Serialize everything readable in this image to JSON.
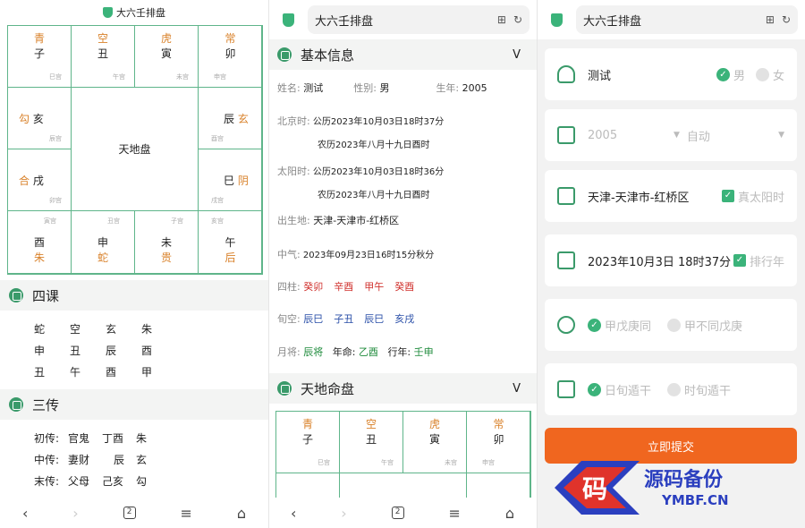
{
  "app": {
    "title": "大六壬排盘"
  },
  "grid": {
    "top": [
      {
        "god": "青",
        "branch": "子",
        "palace": "巳宫"
      },
      {
        "god": "空",
        "branch": "丑",
        "palace": "午宫"
      },
      {
        "god": "虎",
        "branch": "寅",
        "palace": "未宫"
      },
      {
        "god": "常",
        "branch": "卯",
        "palace": "申宫"
      }
    ],
    "left": [
      {
        "god": "勾",
        "branch": "亥",
        "palace": "辰宫"
      },
      {
        "god": "合",
        "branch": "戌",
        "palace": "卯宫"
      }
    ],
    "right": [
      {
        "god": "玄",
        "branch": "辰",
        "palace": "酉宫"
      },
      {
        "god": "阴",
        "branch": "巳",
        "palace": "戌宫"
      }
    ],
    "bottom": [
      {
        "god": "朱",
        "branch": "酉",
        "palace": "寅宫"
      },
      {
        "god": "蛇",
        "branch": "申",
        "palace": "丑宫"
      },
      {
        "god": "贵",
        "branch": "未",
        "palace": "子宫"
      },
      {
        "god": "后",
        "branch": "午",
        "palace": "亥宫"
      }
    ],
    "center": "天地盘"
  },
  "sike": {
    "title": "四课",
    "rows": [
      [
        "蛇",
        "空",
        "玄",
        "朱"
      ],
      [
        "申",
        "丑",
        "辰",
        "酉"
      ],
      [
        "丑",
        "午",
        "酉",
        "甲"
      ]
    ]
  },
  "sanchuan": {
    "title": "三传",
    "rows": [
      [
        "初传:",
        "官鬼",
        "丁酉",
        "朱"
      ],
      [
        "中传:",
        "妻财",
        "辰",
        "玄"
      ],
      [
        "末传:",
        "父母",
        "己亥",
        "勾"
      ]
    ]
  },
  "nav": {
    "back": "‹",
    "forward": "›",
    "tabs": "2",
    "menu": "≡",
    "home": "⌂"
  },
  "basic": {
    "title": "基本信息",
    "toggle": "V",
    "name_label": "姓名:",
    "name": "测试",
    "sex_label": "性别:",
    "sex": "男",
    "year_label": "生年:",
    "year": "2005",
    "bj_label": "北京时:",
    "bj1": "公历2023年10月03日18时37分",
    "bj2": "农历2023年八月十九日酉时",
    "sun_label": "太阳时:",
    "sun1": "公历2023年10月03日18时36分",
    "sun2": "农历2023年八月十九日酉时",
    "place_label": "出生地:",
    "place": "天津-天津市-红桥区",
    "qi_label": "中气:",
    "qi": "2023年09月23日16时15分秋分",
    "sizhu_label": "四柱:",
    "sizhu": [
      "癸卯",
      "辛酉",
      "甲午",
      "癸酉"
    ],
    "xunkong_label": "旬空:",
    "xunkong": [
      "辰巳",
      "子丑",
      "辰巳",
      "亥戌"
    ],
    "yuejiang_label": "月将:",
    "yuejiang": "辰将",
    "ming_label": "年命:",
    "ming": "乙酉",
    "xing_label": "行年:",
    "xing": "壬申"
  },
  "tdmp": {
    "title": "天地命盘",
    "toggle": "V"
  },
  "form": {
    "name": "测试",
    "male": "男",
    "female": "女",
    "year": "2005",
    "auto": "自动",
    "place": "天津-天津市-红桥区",
    "true_sun": "真太阳时",
    "date": "2023年10月3日 18时37分",
    "paixing": "排行年",
    "opt1": "甲戊庚同",
    "opt2": "甲不同戊庚",
    "opt3": "日旬遁干",
    "opt4": "时旬遁干",
    "submit": "立即提交"
  },
  "watermark": {
    "cn": "源码备份",
    "en": "YMBF.CN",
    "glyph": "码"
  }
}
